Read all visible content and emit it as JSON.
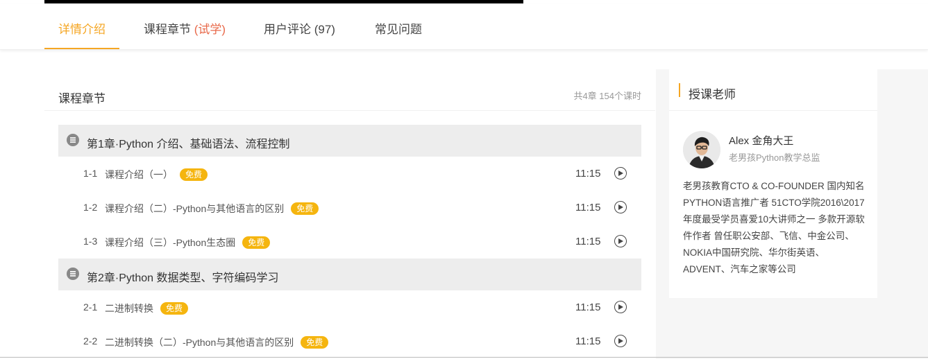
{
  "tabs": [
    {
      "label": "详情介绍"
    },
    {
      "label": "课程章节 ",
      "extra": "(试学)"
    },
    {
      "label": "用户评论 (97)"
    },
    {
      "label": "常见问题"
    }
  ],
  "colors": {
    "accent": "#f5a623",
    "trial": "#e8694a",
    "badge": "#f5b50f"
  },
  "main": {
    "title": "课程章节",
    "stats": "共4章 154个课时"
  },
  "chapters": [
    {
      "title": "第1章·Python 介绍、基础语法、流程控制"
    },
    {
      "title": "第2章·Python 数据类型、字符编码学习"
    }
  ],
  "lessons": [
    {
      "num": "1-1",
      "title": "课程介绍（一）",
      "badge": "免费",
      "time": "11:15",
      "icon": "play-icon"
    },
    {
      "num": "1-2",
      "title": "课程介绍（二）-Python与其他语言的区别",
      "badge": "免费",
      "time": "11:15",
      "icon": "play-icon"
    },
    {
      "num": "1-3",
      "title": "课程介绍（三）-Python生态圈",
      "badge": "免费",
      "time": "11:15",
      "icon": "play-icon"
    },
    {
      "num": "2-1",
      "title": "二进制转换",
      "badge": "免费",
      "time": "11:15",
      "icon": "play-icon"
    },
    {
      "num": "2-2",
      "title": "二进制转换（二）-Python与其他语言的区别",
      "badge": "免费",
      "time": "11:15",
      "icon": "play-icon"
    }
  ],
  "teacher": {
    "section_title": "授课老师",
    "name": "Alex 金角大王",
    "role": "老男孩Python教学总监",
    "description": "老男孩教育CTO & CO-FOUNDER 国内知名PYTHON语言推广者 51CTO学院2016\\2017年度最受学员喜爱10大讲师之一 多款开源软件作者 曾任职公安部、飞信、中金公司、NOKIA中国研究院、华尔街英语、ADVENT、汽车之家等公司"
  }
}
